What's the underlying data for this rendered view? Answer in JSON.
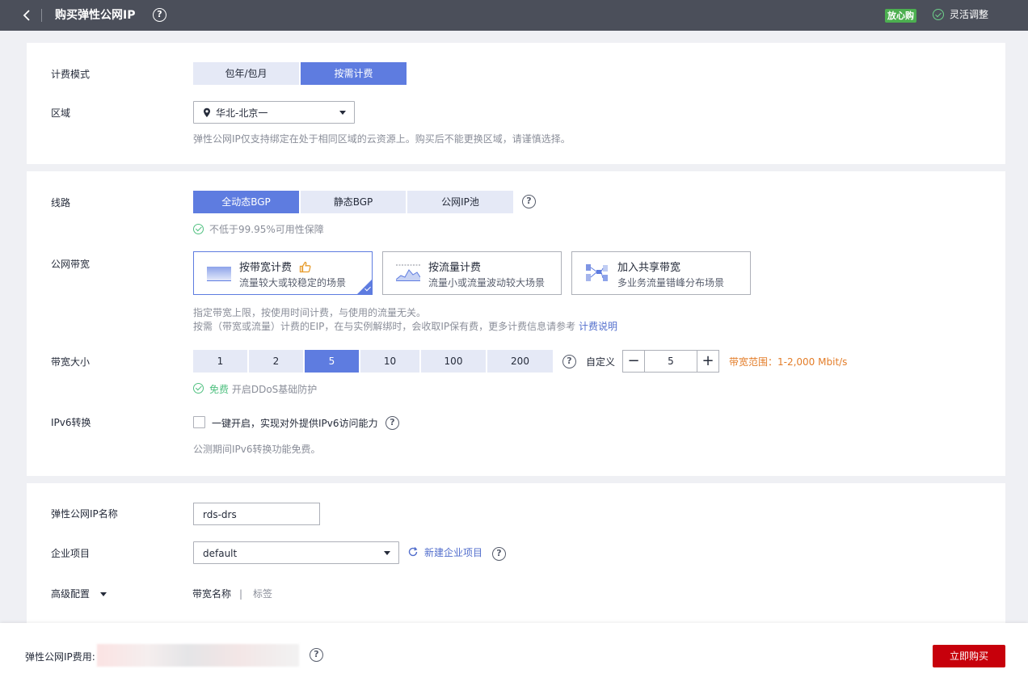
{
  "header": {
    "title": "购买弹性公网IP",
    "help_glyph": "?",
    "badge": "放心购",
    "flex_adjust": "灵活调整"
  },
  "billing": {
    "label": "计费模式",
    "options": [
      "包年/包月",
      "按需计费"
    ],
    "selected": "按需计费"
  },
  "region": {
    "label": "区域",
    "value": "华北-北京一",
    "hint": "弹性公网IP仅支持绑定在处于相同区域的云资源上。购买后不能更换区域，请谨慎选择。"
  },
  "line": {
    "label": "线路",
    "options": [
      "全动态BGP",
      "静态BGP",
      "公网IP池"
    ],
    "selected": "全动态BGP",
    "guarantee": "不低于99.95%可用性保障"
  },
  "bandwidth_type": {
    "label": "公网带宽",
    "cards": [
      {
        "title": "按带宽计费",
        "desc": "流量较大或较稳定的场景",
        "icon": "bandwidth-chart-icon"
      },
      {
        "title": "按流量计费",
        "desc": "流量小或流量波动较大场景",
        "icon": "traffic-chart-icon"
      },
      {
        "title": "加入共享带宽",
        "desc": "多业务流量错峰分布场景",
        "icon": "shared-bandwidth-icon"
      }
    ],
    "selected": "按带宽计费",
    "note1": "指定带宽上限，按使用时间计费，与使用的流量无关。",
    "note2_prefix": "按需（带宽或流量）计费的EIP，在与实例解绑时，会收取IP保有费，更多计费信息请参考",
    "note2_link": "计费说明"
  },
  "bandwidth_size": {
    "label": "带宽大小",
    "options": [
      "1",
      "2",
      "5",
      "10",
      "100",
      "200"
    ],
    "selected": "5",
    "custom_label": "自定义",
    "custom_value": "5",
    "minus": "−",
    "plus": "+",
    "range": "带宽范围：1-2,000 Mbit/s",
    "ddos_free": "免费",
    "ddos_text": "开启DDoS基础防护"
  },
  "ipv6": {
    "label": "IPv6转换",
    "checkbox_label": "一键开启，实现对外提供IPv6访问能力",
    "hint": "公测期间IPv6转换功能免费。"
  },
  "eip_name": {
    "label": "弹性公网IP名称",
    "value": "rds-drs"
  },
  "enterprise": {
    "label": "企业项目",
    "value": "default",
    "new_link": "新建企业项目"
  },
  "advanced": {
    "label": "高级配置",
    "tab1": "带宽名称",
    "divider": "|",
    "tab2": "标签"
  },
  "footer": {
    "fee_label": "弹性公网IP费用:",
    "buy_label": "立即购买"
  },
  "colors": {
    "accent": "#5e7ce0",
    "buy": "#c7000b",
    "success": "#50c080",
    "warning": "#e37d29",
    "link": "#526ecc"
  }
}
